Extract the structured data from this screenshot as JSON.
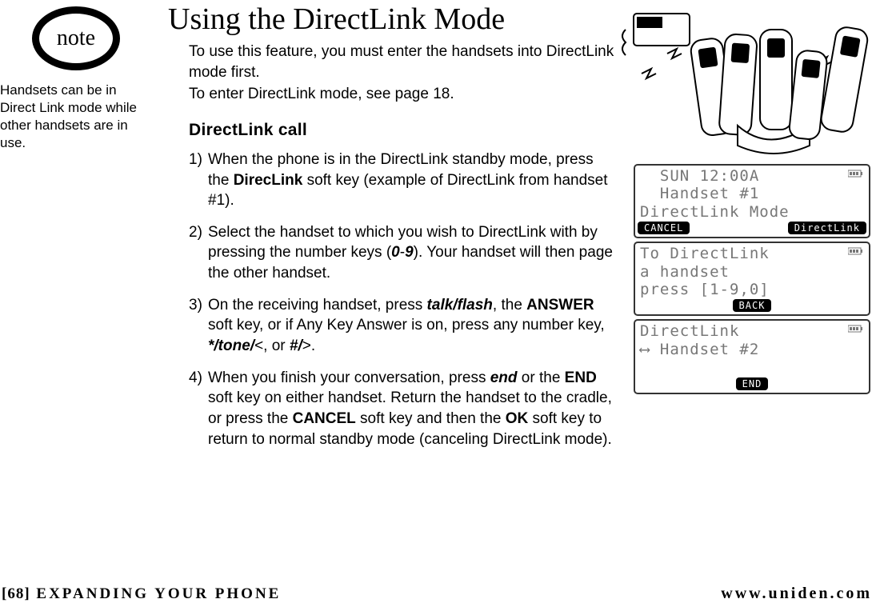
{
  "note": {
    "badge_label": "note",
    "text": "Handsets can be in Direct Link mode while other handsets are in use."
  },
  "title": "Using the DirectLink Mode",
  "intro": {
    "line1": "To use this feature, you must enter the handsets into DirectLink mode first.",
    "line2": "To enter DirectLink mode, see page 18."
  },
  "subhead": "DirectLink call",
  "steps": {
    "s1": {
      "num": "1)",
      "pre": "When the phone is in the DirectLink standby mode, press the ",
      "b1": "DirecLink",
      "post": " soft key (example of DirectLink from handset #1)."
    },
    "s2": {
      "num": "2)",
      "pre": "Select the handset to which you wish to DirectLink with by pressing the number keys (",
      "bi1": "0",
      "dash": "-",
      "bi2": "9",
      "post": "). Your handset will then page the other handset."
    },
    "s3": {
      "num": "3)",
      "pre": "On the receiving handset, press ",
      "bi1": "talk/flash",
      "mid1": ", the ",
      "b1": "ANSWER",
      "mid2": " soft key, or if Any Key Answer is on, press any number key, ",
      "bi2": "*/tone/",
      "lt": "<",
      "mid3": ", or ",
      "bi3": "#/",
      "gt": ">",
      "post": "."
    },
    "s4": {
      "num": "4)",
      "pre": "When you finish your conversation, press ",
      "bi1": "end",
      "mid1": " or the ",
      "b1": "END",
      "mid2": " soft key on either handset. Return the handset to the cradle, or press the ",
      "b2": "CANCEL",
      "mid3": " soft key and then the ",
      "b3": "OK",
      "post": " soft key to return to normal standby mode (canceling DirectLink mode)."
    }
  },
  "screens": {
    "a": {
      "l1": "  SUN 12:00A",
      "l2": "  Handset #1",
      "l3": "DirectLink Mode",
      "left": "CANCEL",
      "right": "DirectLink"
    },
    "b": {
      "l1": "To DirectLink",
      "l2": "a handset",
      "l3": "press [1-9,0]",
      "center": "BACK"
    },
    "c": {
      "l1": "DirectLink",
      "l2": "⟷ Handset #2",
      "center": "END"
    }
  },
  "footer": {
    "left_page": "[68]",
    "left_section": " EXPANDING YOUR PHONE",
    "right": "www.uniden.com"
  }
}
